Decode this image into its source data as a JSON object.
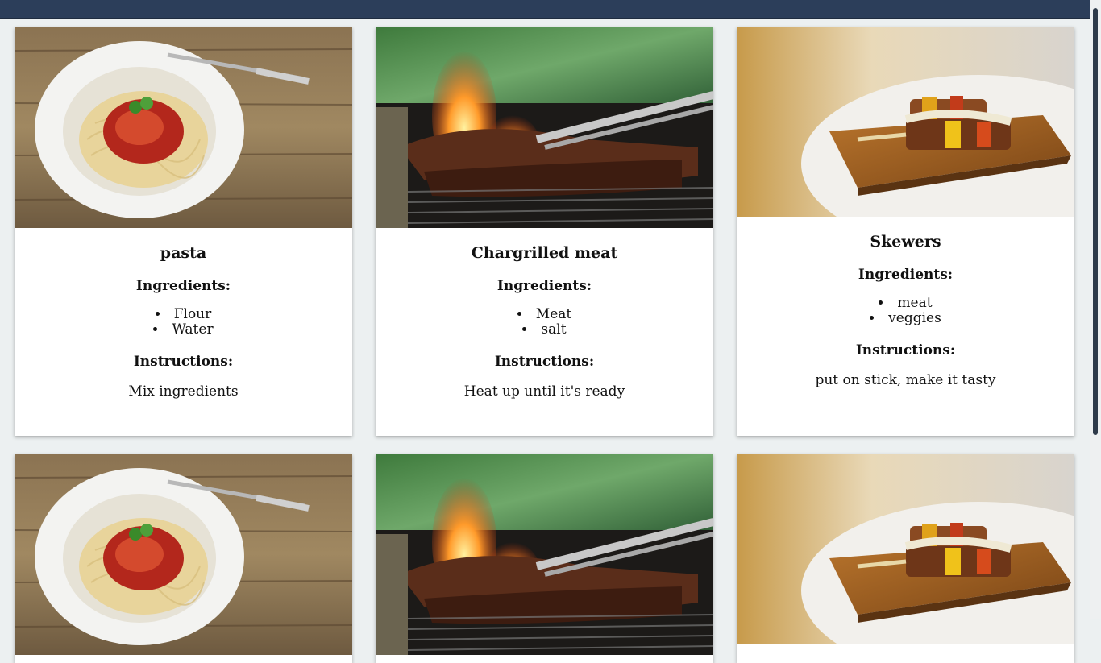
{
  "cards": [
    {
      "title": "pasta",
      "ingredients_heading": "Ingredients:",
      "ingredients": [
        "Flour",
        "Water"
      ],
      "instructions_heading": "Instructions:",
      "instructions": "Mix ingredients",
      "image": "pasta-photo"
    },
    {
      "title": "Chargrilled meat",
      "ingredients_heading": "Ingredients:",
      "ingredients": [
        "Meat",
        "salt"
      ],
      "instructions_heading": "Instructions:",
      "instructions": "Heat up until it's ready",
      "image": "grill-photo"
    },
    {
      "title": "Skewers",
      "ingredients_heading": "Ingredients:",
      "ingredients": [
        "meat",
        "veggies"
      ],
      "instructions_heading": "Instructions:",
      "instructions": "put on stick, make it tasty",
      "image": "skewers-photo"
    }
  ],
  "colors": {
    "topbar": "#2c3e5a",
    "page_background": "#ecf0f1",
    "card_background": "#ffffff"
  }
}
